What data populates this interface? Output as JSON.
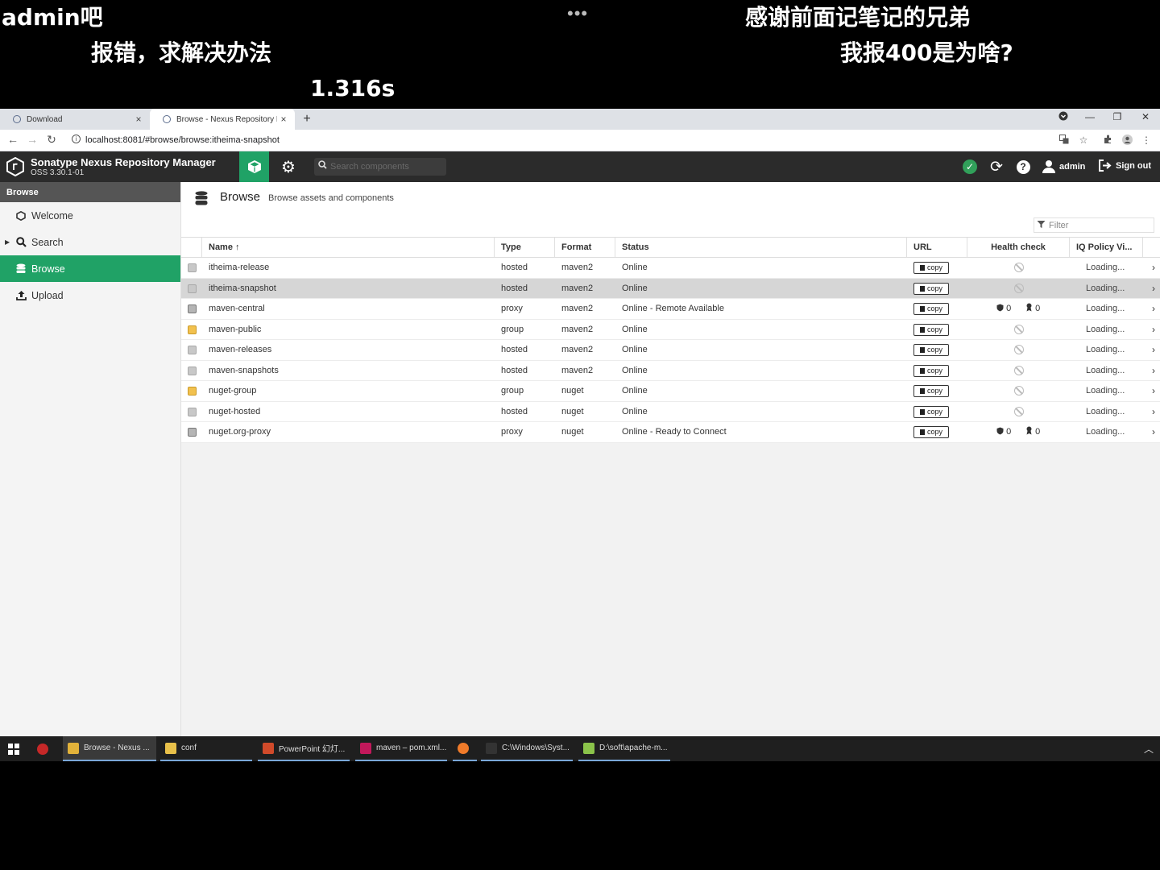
{
  "danmaku": {
    "line1": "admin吧",
    "line2": "报错，求解决办法",
    "line3": "1.316s",
    "line4": "感谢前面记笔记的兄弟",
    "line5": "我报400是为啥?",
    "dots": "•••"
  },
  "browser": {
    "tabs": [
      {
        "title": "Download",
        "close": "×"
      },
      {
        "title": "Browse - Nexus Repository M...",
        "close": "×"
      }
    ],
    "new_tab": "+",
    "url": "localhost:8081/#browse/browse:itheima-snapshot",
    "window_controls": {
      "minimize": "—",
      "restore": "❐",
      "close": "✕"
    }
  },
  "nexus": {
    "title": "Sonatype Nexus Repository Manager",
    "version": "OSS 3.30.1-01",
    "search_placeholder": "Search components",
    "user": "admin",
    "signout": "Sign out"
  },
  "sidebar": {
    "header": "Browse",
    "items": [
      {
        "label": "Welcome"
      },
      {
        "label": "Search"
      },
      {
        "label": "Browse"
      },
      {
        "label": "Upload"
      }
    ]
  },
  "page": {
    "title": "Browse",
    "subtitle": "Browse assets and components",
    "filter_placeholder": "Filter"
  },
  "table": {
    "columns": [
      "Name ↑",
      "Type",
      "Format",
      "Status",
      "URL",
      "Health check",
      "IQ Policy Vi..."
    ],
    "copy_label": "copy",
    "loading_label": "Loading...",
    "rows": [
      {
        "name": "itheima-release",
        "type": "hosted",
        "format": "maven2",
        "status": "Online",
        "health": ""
      },
      {
        "name": "itheima-snapshot",
        "type": "hosted",
        "format": "maven2",
        "status": "Online",
        "health": ""
      },
      {
        "name": "maven-central",
        "type": "proxy",
        "format": "maven2",
        "status": "Online - Remote Available",
        "health": "counts",
        "h1": "0",
        "h2": "0"
      },
      {
        "name": "maven-public",
        "type": "group",
        "format": "maven2",
        "status": "Online",
        "health": ""
      },
      {
        "name": "maven-releases",
        "type": "hosted",
        "format": "maven2",
        "status": "Online",
        "health": ""
      },
      {
        "name": "maven-snapshots",
        "type": "hosted",
        "format": "maven2",
        "status": "Online",
        "health": ""
      },
      {
        "name": "nuget-group",
        "type": "group",
        "format": "nuget",
        "status": "Online",
        "health": ""
      },
      {
        "name": "nuget-hosted",
        "type": "hosted",
        "format": "nuget",
        "status": "Online",
        "health": ""
      },
      {
        "name": "nuget.org-proxy",
        "type": "proxy",
        "format": "nuget",
        "status": "Online - Ready to Connect",
        "health": "counts",
        "h1": "0",
        "h2": "0"
      }
    ]
  },
  "taskbar": {
    "items": [
      {
        "label": "Browse - Nexus ...",
        "color": "#e2b23a"
      },
      {
        "label": "conf",
        "color": "#e8c04a"
      },
      {
        "label": "PowerPoint 幻灯...",
        "color": "#d04a2a"
      },
      {
        "label": "maven – pom.xml...",
        "color": "#c2185b"
      },
      {
        "label": "",
        "color": "#f07b2a"
      },
      {
        "label": "C:\\Windows\\Syst...",
        "color": "#333333"
      },
      {
        "label": "D:\\soft\\apache-m...",
        "color": "#8bc34a"
      }
    ]
  },
  "colors": {
    "accent": "#20a266",
    "header_bg": "#2b2b2b",
    "status_ok": "#31a05a"
  }
}
